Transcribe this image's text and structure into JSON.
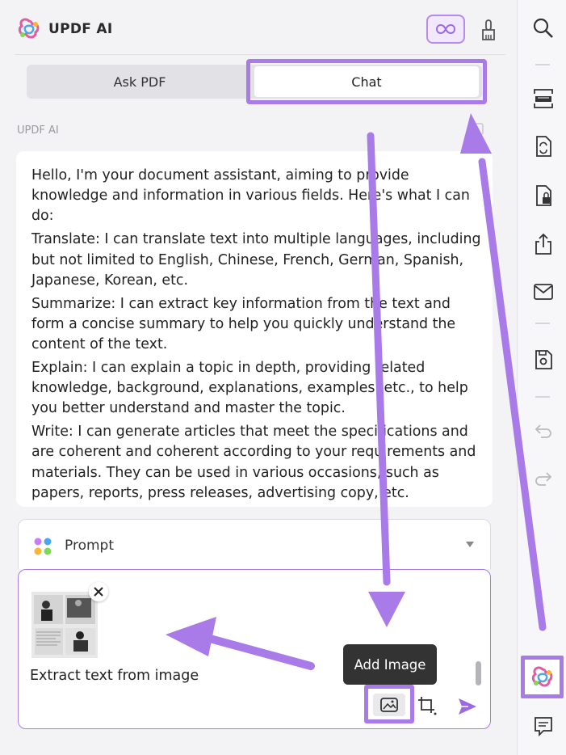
{
  "header": {
    "brand": "UPDF AI"
  },
  "tabs": {
    "ask_pdf": "Ask PDF",
    "chat": "Chat"
  },
  "message": {
    "sender": "UPDF AI",
    "paragraphs": [
      "Hello, I'm your document assistant, aiming to provide knowledge and information in various fields. Here's what I can do:",
      "Translate: I can translate text into multiple languages, including but not limited to English, Chinese, French, German, Spanish, Japanese, Korean, etc.",
      "Summarize: I can extract key information from the text and form a concise summary to help you quickly understand the content of the text.",
      "Explain: I can explain a topic in depth, providing related knowledge, background, explanations, examples, etc., to help you better understand and master the topic.",
      "Write: I can generate articles that meet the specifications and are coherent and coherent according to your requirements and materials. They can be used in various occasions, such as papers, reports, press releases, advertising copy, etc."
    ]
  },
  "prompt": {
    "label": "Prompt"
  },
  "input": {
    "value": "Extract text from image"
  },
  "tooltip": {
    "text": "Add Image"
  },
  "colors": {
    "accent": "#a97be8",
    "background": "#f3f2f5"
  },
  "icons": {
    "header": [
      "infinity-icon",
      "broom-icon"
    ],
    "rail": [
      "search-icon",
      "ocr-icon",
      "convert-icon",
      "protect-icon",
      "share-icon",
      "mail-icon",
      "save-icon",
      "undo-icon",
      "redo-icon",
      "updf-ai-icon",
      "comment-icon"
    ]
  }
}
